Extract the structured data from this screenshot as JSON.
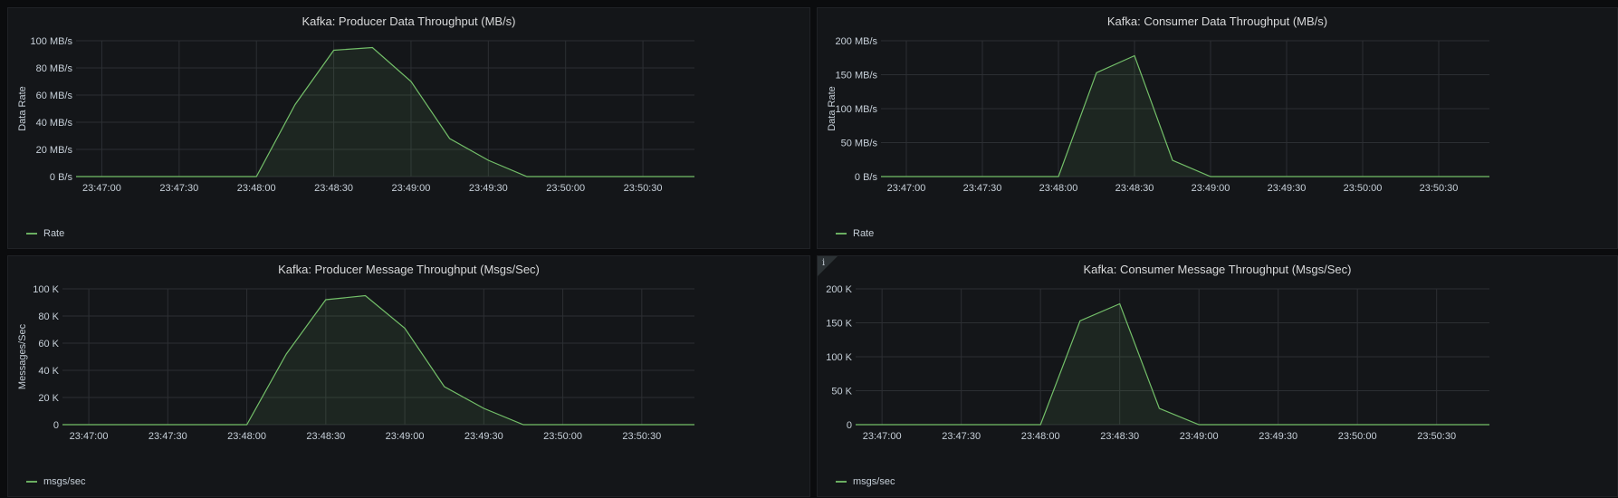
{
  "colors": {
    "series": "#73bf69",
    "grid": "#2c2f33",
    "text": "#c7d0d9",
    "panel": "#141619"
  },
  "panels": [
    {
      "title": "Kafka: Producer Data Throughput (MB/s)",
      "legend": "Rate",
      "has_info": false
    },
    {
      "title": "Kafka: Consumer Data Throughput (MB/s)",
      "legend": "Rate",
      "has_info": false
    },
    {
      "title": "Kafka: Producer Message Throughput (Msgs/Sec)",
      "legend": "msgs/sec",
      "has_info": false
    },
    {
      "title": "Kafka: Consumer Message Throughput (Msgs/Sec)",
      "legend": "msgs/sec",
      "has_info": true,
      "info_glyph": "i",
      "info_icon": "info-icon"
    }
  ],
  "chart_data": [
    {
      "type": "area",
      "title": "Kafka: Producer Data Throughput (MB/s)",
      "ylabel": "Data Rate",
      "ylim": [
        0,
        100
      ],
      "y_ticks": [
        0,
        20,
        40,
        60,
        80,
        100
      ],
      "y_tick_labels": [
        "0 B/s",
        "20 MB/s",
        "40 MB/s",
        "60 MB/s",
        "80 MB/s",
        "100 MB/s"
      ],
      "x_range": [
        "23:46:50",
        "23:50:50"
      ],
      "x_ticks": [
        "23:47:00",
        "23:47:30",
        "23:48:00",
        "23:48:30",
        "23:49:00",
        "23:49:30",
        "23:50:00",
        "23:50:30"
      ],
      "grid": true,
      "legend_position": "bottom-left",
      "series": [
        {
          "name": "Rate",
          "x": [
            "23:46:50",
            "23:47:00",
            "23:47:15",
            "23:47:30",
            "23:47:45",
            "23:48:00",
            "23:48:15",
            "23:48:30",
            "23:48:45",
            "23:49:00",
            "23:49:15",
            "23:49:30",
            "23:49:45",
            "23:50:00",
            "23:50:15",
            "23:50:30",
            "23:50:50"
          ],
          "values": [
            0,
            0,
            0,
            0,
            0,
            0,
            53,
            93,
            95,
            70,
            28,
            12,
            0,
            0,
            0,
            0,
            0
          ]
        }
      ]
    },
    {
      "type": "area",
      "title": "Kafka: Consumer Data Throughput (MB/s)",
      "ylabel": "Data Rate",
      "ylim": [
        0,
        200
      ],
      "y_ticks": [
        0,
        50,
        100,
        150,
        200
      ],
      "y_tick_labels": [
        "0 B/s",
        "50 MB/s",
        "100 MB/s",
        "150 MB/s",
        "200 MB/s"
      ],
      "x_range": [
        "23:46:50",
        "23:50:50"
      ],
      "x_ticks": [
        "23:47:00",
        "23:47:30",
        "23:48:00",
        "23:48:30",
        "23:49:00",
        "23:49:30",
        "23:50:00",
        "23:50:30"
      ],
      "grid": true,
      "legend_position": "bottom-left",
      "series": [
        {
          "name": "Rate",
          "x": [
            "23:46:50",
            "23:47:00",
            "23:47:15",
            "23:47:30",
            "23:47:45",
            "23:48:00",
            "23:48:15",
            "23:48:30",
            "23:48:45",
            "23:49:00",
            "23:49:15",
            "23:49:30",
            "23:49:45",
            "23:50:00",
            "23:50:15",
            "23:50:30",
            "23:50:50"
          ],
          "values": [
            0,
            0,
            0,
            0,
            0,
            0,
            153,
            178,
            24,
            0,
            0,
            0,
            0,
            0,
            0,
            0,
            0
          ]
        }
      ]
    },
    {
      "type": "area",
      "title": "Kafka: Producer Message Throughput (Msgs/Sec)",
      "ylabel": "Messages/Sec",
      "ylim": [
        0,
        100000
      ],
      "y_ticks": [
        0,
        20000,
        40000,
        60000,
        80000,
        100000
      ],
      "y_tick_labels": [
        "0",
        "20 K",
        "40 K",
        "60 K",
        "80 K",
        "100 K"
      ],
      "x_range": [
        "23:46:50",
        "23:50:50"
      ],
      "x_ticks": [
        "23:47:00",
        "23:47:30",
        "23:48:00",
        "23:48:30",
        "23:49:00",
        "23:49:30",
        "23:50:00",
        "23:50:30"
      ],
      "grid": true,
      "legend_position": "bottom-left",
      "series": [
        {
          "name": "msgs/sec",
          "x": [
            "23:46:50",
            "23:47:00",
            "23:47:15",
            "23:47:30",
            "23:47:45",
            "23:48:00",
            "23:48:15",
            "23:48:30",
            "23:48:45",
            "23:49:00",
            "23:49:15",
            "23:49:30",
            "23:49:45",
            "23:50:00",
            "23:50:15",
            "23:50:30",
            "23:50:50"
          ],
          "values": [
            0,
            0,
            0,
            0,
            0,
            0,
            52000,
            92000,
            95000,
            71000,
            28000,
            12000,
            0,
            0,
            0,
            0,
            0
          ]
        }
      ]
    },
    {
      "type": "area",
      "title": "Kafka: Consumer Message Throughput (Msgs/Sec)",
      "ylabel": "",
      "ylim": [
        0,
        200000
      ],
      "y_ticks": [
        0,
        50000,
        100000,
        150000,
        200000
      ],
      "y_tick_labels": [
        "0",
        "50 K",
        "100 K",
        "150 K",
        "200 K"
      ],
      "x_range": [
        "23:46:50",
        "23:50:50"
      ],
      "x_ticks": [
        "23:47:00",
        "23:47:30",
        "23:48:00",
        "23:48:30",
        "23:49:00",
        "23:49:30",
        "23:50:00",
        "23:50:30"
      ],
      "grid": true,
      "legend_position": "bottom-left",
      "series": [
        {
          "name": "msgs/sec",
          "x": [
            "23:46:50",
            "23:47:00",
            "23:47:15",
            "23:47:30",
            "23:47:45",
            "23:48:00",
            "23:48:15",
            "23:48:30",
            "23:48:45",
            "23:49:00",
            "23:49:15",
            "23:49:30",
            "23:49:45",
            "23:50:00",
            "23:50:15",
            "23:50:30",
            "23:50:50"
          ],
          "values": [
            0,
            0,
            0,
            0,
            0,
            0,
            153000,
            178000,
            24000,
            0,
            0,
            0,
            0,
            0,
            0,
            0,
            0
          ]
        }
      ]
    }
  ]
}
